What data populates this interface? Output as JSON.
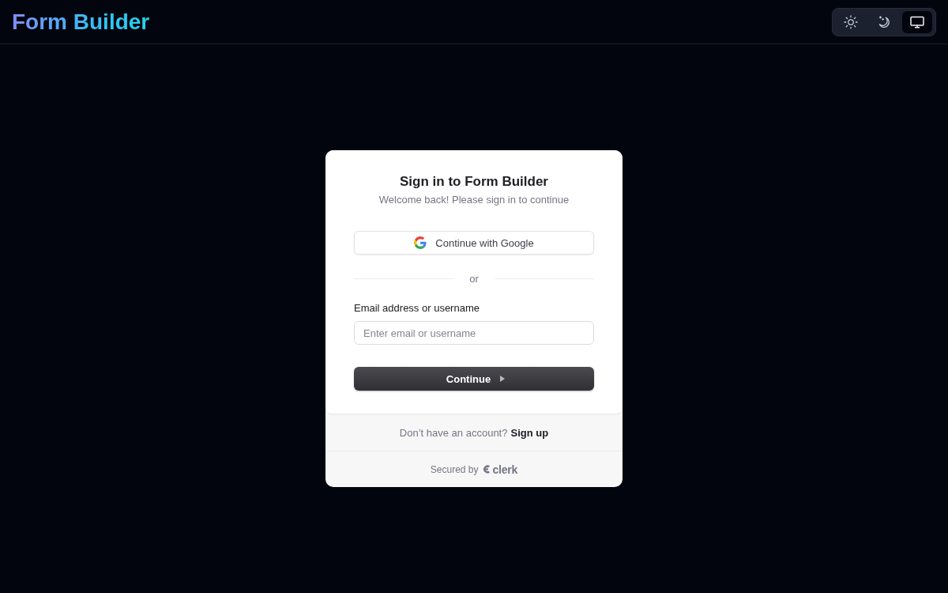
{
  "header": {
    "title": "Form Builder",
    "theme_switcher": [
      {
        "kind": "light",
        "selected": false
      },
      {
        "kind": "dark",
        "selected": false
      },
      {
        "kind": "system",
        "selected": true
      }
    ]
  },
  "sign_in_card": {
    "title": "Sign in to Form Builder",
    "subtitle": "Welcome back! Please sign in to continue",
    "social_button": "Continue with Google",
    "divider": "or",
    "field": {
      "label": "Email address or username",
      "placeholder": "Enter email or username"
    },
    "submit_button": "Continue",
    "footer": {
      "prompt": "Don’t have an account?",
      "link": "Sign up"
    },
    "secured_by": {
      "text": "Secured by",
      "brand": "clerk"
    }
  }
}
